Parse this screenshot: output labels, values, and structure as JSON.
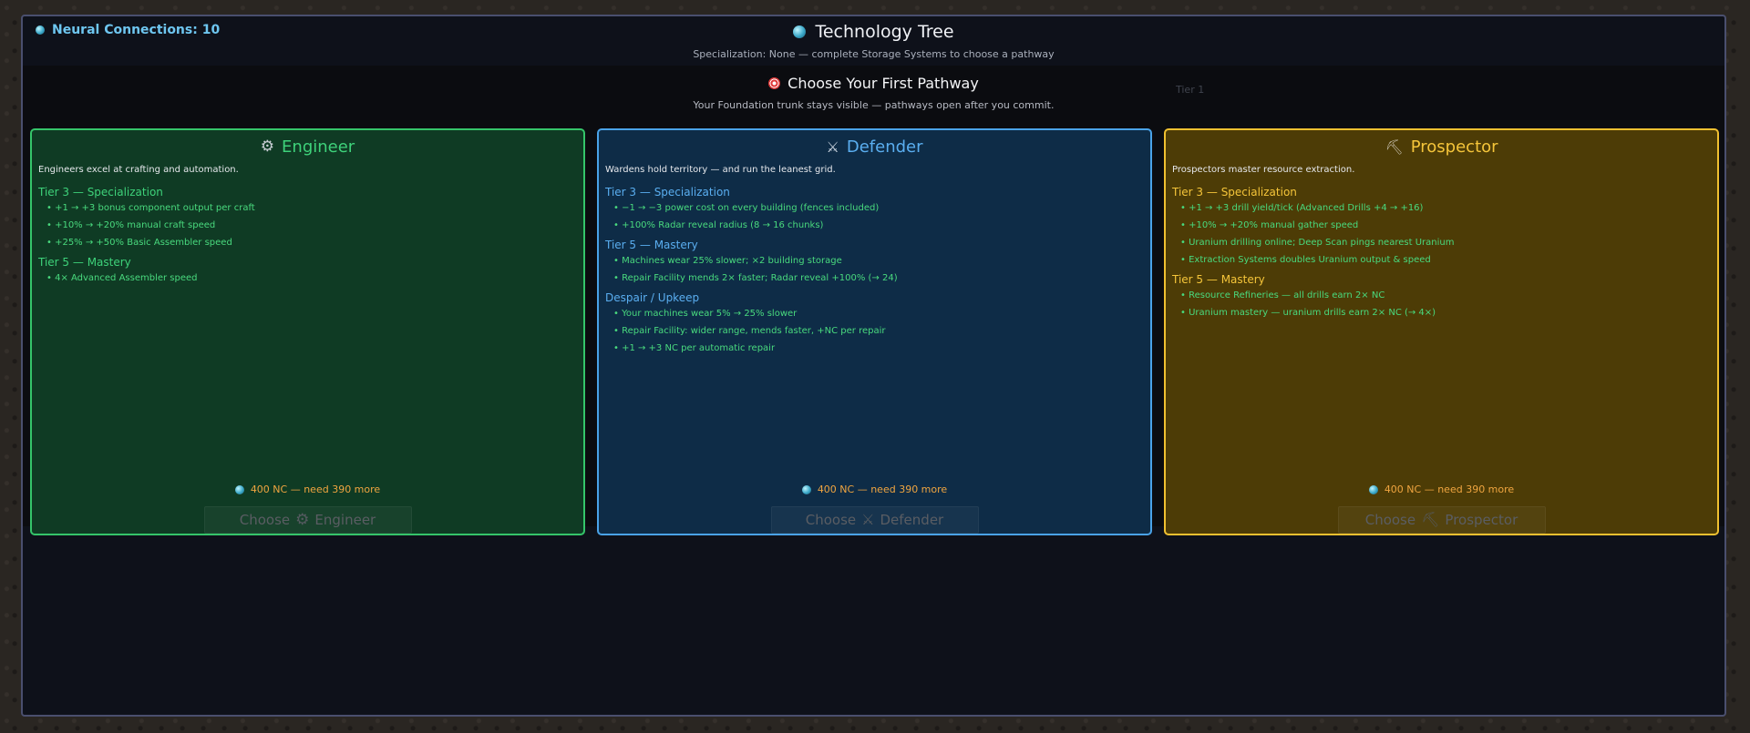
{
  "top": {
    "neural_connections": "Neural Connections: 10",
    "title": "Technology Tree",
    "subtitle": "Specialization: None — complete Storage Systems to choose a pathway"
  },
  "modal": {
    "title": "Choose Your First Pathway",
    "subtitle": "Your Foundation trunk stays visible — pathways open after you commit.",
    "tier_label": "Tier 1"
  },
  "cards": [
    {
      "name": "Engineer",
      "icon": "gear-icon",
      "accent": "#35c56a",
      "description": "Engineers excel at crafting and automation.",
      "sections": [
        {
          "title": "Tier 3 — Specialization",
          "items": [
            "• +1 → +3 bonus component output per craft",
            "• +10% → +20% manual craft speed",
            "• +25% → +50% Basic Assembler speed"
          ]
        },
        {
          "title": "Tier 5 — Mastery",
          "items": [
            "• 4× Advanced Assembler speed"
          ]
        }
      ],
      "cost": "400 NC — need 390 more",
      "choose_label": "Choose",
      "choose_name": "Engineer"
    },
    {
      "name": "Defender",
      "icon": "crossed-swords-icon",
      "accent": "#4aa3e8",
      "description": "Wardens hold territory — and run the leanest grid.",
      "sections": [
        {
          "title": "Tier 3 — Specialization",
          "items": [
            "• −1 → −3 power cost on every building (fences included)",
            "• +100% Radar reveal radius (8 → 16 chunks)"
          ]
        },
        {
          "title": "Tier 5 — Mastery",
          "items": [
            "• Machines wear 25% slower; ×2 building storage",
            "• Repair Facility mends 2× faster; Radar reveal +100% (→ 24)"
          ]
        },
        {
          "title": "Despair / Upkeep",
          "items": [
            "• Your machines wear 5% → 25% slower",
            "• Repair Facility: wider range, mends faster, +NC per repair",
            "• +1 → +3 NC per automatic repair"
          ]
        }
      ],
      "cost": "400 NC — need 390 more",
      "choose_label": "Choose",
      "choose_name": "Defender"
    },
    {
      "name": "Prospector",
      "icon": "pickaxe-icon",
      "accent": "#f0c030",
      "description": "Prospectors master resource extraction.",
      "sections": [
        {
          "title": "Tier 3 — Specialization",
          "items": [
            "• +1 → +3 drill yield/tick (Advanced Drills +4 → +16)",
            "• +10% → +20% manual gather speed",
            "• Uranium drilling online; Deep Scan pings nearest Uranium",
            "• Extraction Systems doubles Uranium output & speed"
          ]
        },
        {
          "title": "Tier 5 — Mastery",
          "items": [
            "• Resource Refineries — all drills earn 2× NC",
            "• Uranium mastery — uranium drills earn 2× NC (→ 4×)"
          ]
        }
      ],
      "cost": "400 NC — need 390 more",
      "choose_label": "Choose",
      "choose_name": "Prospector"
    }
  ]
}
